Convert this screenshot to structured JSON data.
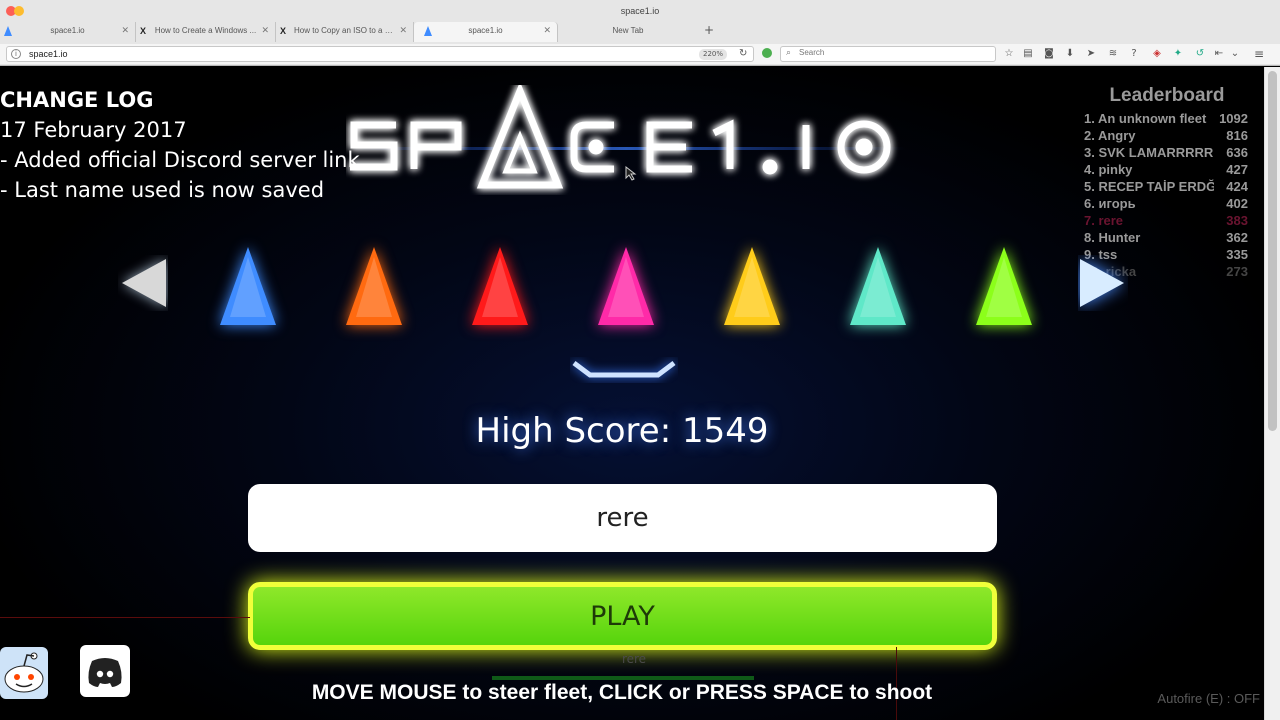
{
  "browser": {
    "window_title": "space1.io",
    "tabs": [
      {
        "label": "space1.io",
        "favicon": "blue-triangle-icon",
        "active": false
      },
      {
        "label": "How to Create a Windows ...",
        "favicon": "x-icon",
        "active": false
      },
      {
        "label": "How to Copy an ISO to a U...",
        "favicon": "x-icon",
        "active": false
      },
      {
        "label": "space1.io",
        "favicon": "blue-triangle-icon",
        "active": true
      },
      {
        "label": "New Tab",
        "favicon": "",
        "active": false
      }
    ],
    "url": "space1.io",
    "zoom": "220%",
    "search_placeholder": "Search"
  },
  "changelog": {
    "title": "CHANGE LOG",
    "date": "17 February 2017",
    "items": [
      "- Added official Discord server link",
      "- Last name used is now saved"
    ]
  },
  "logo_text": "SPACE1.IO",
  "leaderboard": {
    "title": "Leaderboard",
    "rows": [
      {
        "name": "1. An unknown fleet",
        "score": "1092"
      },
      {
        "name": "2. Angry",
        "score": "816"
      },
      {
        "name": "3. SVK LAMARRRRRRRR",
        "score": "636"
      },
      {
        "name": "4. pinky",
        "score": "427"
      },
      {
        "name": "5. RECEP TAİP ERDĞ",
        "score": "424"
      },
      {
        "name": "6. игорь",
        "score": "402"
      },
      {
        "name": "7. rere",
        "score": "383",
        "me": true
      },
      {
        "name": "8. Hunter",
        "score": "362"
      },
      {
        "name": "9. tss",
        "score": "335"
      },
      {
        "name": "10. ricka",
        "score": "273",
        "faded": true
      }
    ]
  },
  "ships": [
    {
      "name": "blue-ship-icon",
      "color": "#3f8cff"
    },
    {
      "name": "orange-ship-icon",
      "color": "#ff6a10"
    },
    {
      "name": "red-ship-icon",
      "color": "#ff1a1a"
    },
    {
      "name": "pink-ship-icon",
      "color": "#ff2aa8",
      "selected": true
    },
    {
      "name": "yellow-ship-icon",
      "color": "#ffcc1a"
    },
    {
      "name": "teal-ship-icon",
      "color": "#5fe8c8"
    },
    {
      "name": "lime-ship-icon",
      "color": "#8cff1a"
    }
  ],
  "high_score": "High Score: 1549",
  "name_input_value": "rere",
  "play_label": "PLAY",
  "ghost_name": "rere",
  "instructions": "MOVE MOUSE to steer fleet, CLICK or PRESS SPACE to shoot",
  "autofire": "Autofire (E) : OFF",
  "colors": {
    "accent_blue": "#3f8cff",
    "play_green": "#6ad81a",
    "play_border": "#f0ff3a"
  }
}
